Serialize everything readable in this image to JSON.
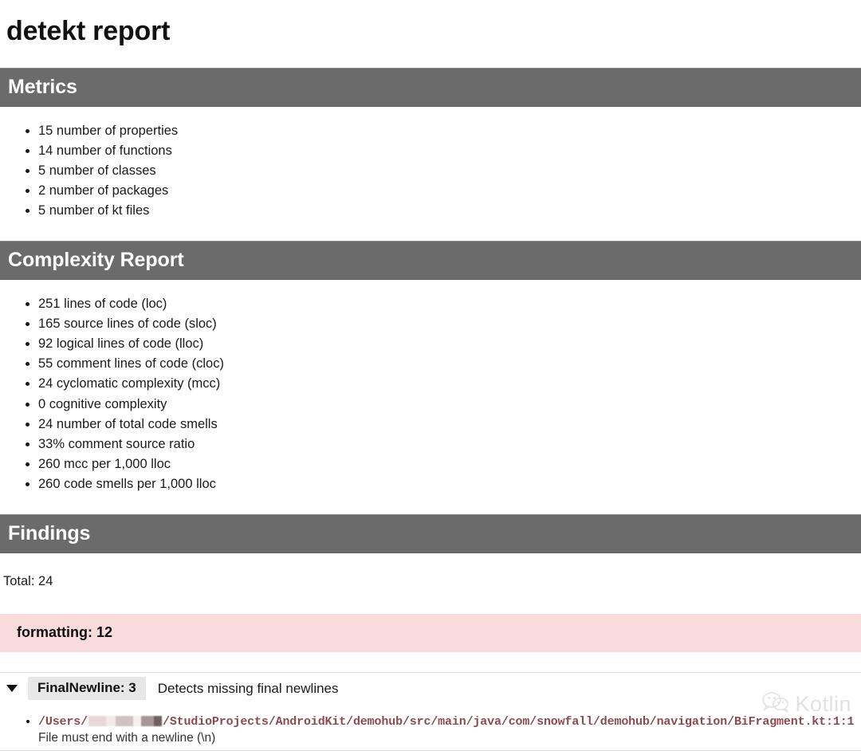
{
  "report": {
    "title": "detekt report"
  },
  "sections": {
    "metrics": {
      "heading": "Metrics",
      "items": [
        "15 number of properties",
        "14 number of functions",
        "5 number of classes",
        "2 number of packages",
        "5 number of kt files"
      ]
    },
    "complexity": {
      "heading": "Complexity Report",
      "items": [
        "251 lines of code (loc)",
        "165 source lines of code (sloc)",
        "92 logical lines of code (lloc)",
        "55 comment lines of code (cloc)",
        "24 cyclomatic complexity (mcc)",
        "0 cognitive complexity",
        "24 number of total code smells",
        "33% comment source ratio",
        "260 mcc per 1,000 lloc",
        "260 code smells per 1,000 lloc"
      ]
    },
    "findings": {
      "heading": "Findings",
      "total_label": "Total: 24",
      "rulesets": [
        {
          "label": "formatting: 12",
          "rules": [
            {
              "chip": "FinalNewline: 3",
              "description": "Detects missing final newlines",
              "entries": [
                {
                  "path_prefix": "/Users/",
                  "path_suffix": "/StudioProjects/AndroidKit/demohub/src/main/java/com/snowfall/demohub/navigation/BiFragment.kt:1:1",
                  "message": "File must end with a newline (\\n)"
                }
              ]
            }
          ]
        }
      ]
    }
  },
  "watermark": {
    "text": "Kotlin",
    "logo": "wechat-logo-icon"
  },
  "colors": {
    "section_bar": "#6b6b6b",
    "ruleset_banner": "#f8dcdc",
    "rule_chip": "#e7e7e7",
    "path_link": "#8c4a50"
  }
}
